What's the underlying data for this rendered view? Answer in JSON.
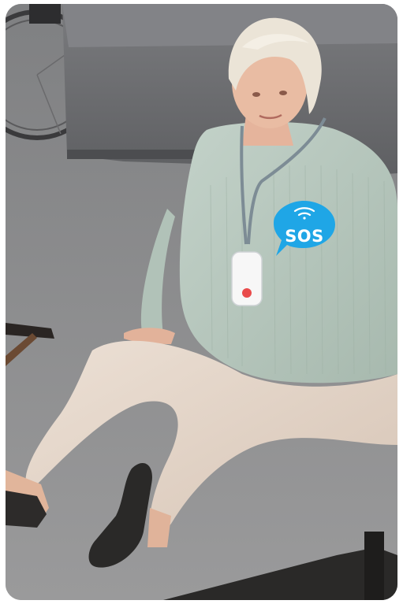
{
  "photo": {
    "sos_badge": {
      "label": "SOS",
      "color": "#1fa6e6",
      "icon": "wireless-signal-icon"
    },
    "pendant": {
      "button_color": "#e94b4b"
    },
    "colors": {
      "carpet": "#8d8d8e",
      "sofa": "#6f7073",
      "sweater": "#b8c8bf",
      "trousers": "#e2d3c6",
      "hair": "#e6dfd2",
      "skin": "#e7b9a0"
    }
  }
}
